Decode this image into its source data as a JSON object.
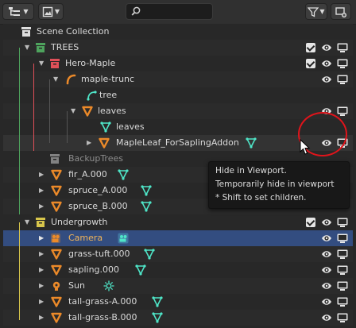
{
  "header": {
    "display_mode_icon": "outliner-display-icon",
    "filter_icon": "filter-icon",
    "new_collection_icon": "new-collection-icon",
    "search_icon": "search-icon",
    "search_value": ""
  },
  "colors": {
    "accent_orange": "#ec8a29",
    "collection_green": "#4ea35d",
    "collection_red": "#e05059",
    "collection_yellow": "#d7c54b",
    "object_data_cyan": "#4fe6c8",
    "selection_blue": "#334d80",
    "annotation_red": "#e0141b"
  },
  "tree": {
    "scene_collection": "Scene Collection",
    "trees": "TREES",
    "hero_maple": "Hero-Maple",
    "maple_trunc": "maple-trunc",
    "tree_mesh": "tree",
    "leaves_obj": "leaves",
    "leaves_mesh": "leaves",
    "maple_leaf": "MapleLeaf_ForSaplingAddon",
    "backup_trees": "BackupTrees",
    "fir": "fir_A.000",
    "spruce_a": "spruce_A.000",
    "spruce_b": "spruce_B.000",
    "undergrowth": "Undergrowth",
    "camera": "Camera",
    "grass_tuft": "grass-tuft.000",
    "sapling": "sapling.000",
    "sun": "Sun",
    "tall_grass_a": "tall-grass-A.000",
    "tall_grass_b": "tall-grass-B.000"
  },
  "tooltip": {
    "title": "Hide in Viewport.",
    "line1": "Temporarily hide in viewport",
    "line2": "* Shift to set children."
  }
}
